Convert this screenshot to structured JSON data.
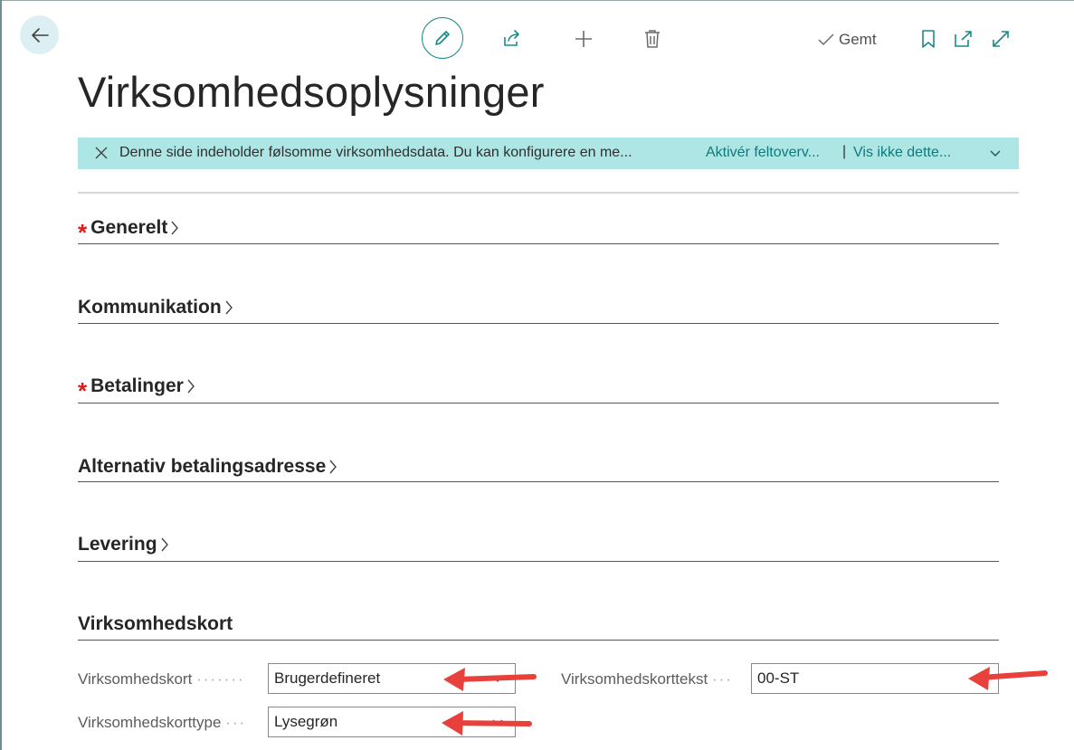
{
  "toolbar": {
    "back_icon": "arrow-left-icon",
    "edit_icon": "pencil-icon",
    "share_icon": "share-icon",
    "new_icon": "plus-icon",
    "delete_icon": "trash-icon",
    "saved_label": "Gemt",
    "bookmark_icon": "bookmark-icon",
    "popout_icon": "open-in-new-window-icon",
    "expand_icon": "expand-icon",
    "accent_color": "#1a8a86"
  },
  "page": {
    "title": "Virksomhedsoplysninger"
  },
  "banner": {
    "message": "Denne side indeholder følsomme virksomhedsdata. Du kan konfigurere en me...",
    "action1": "Aktivér feltoverv...",
    "separator": "|",
    "action2": "Vis ikke dette...",
    "background_color": "#aee6e6"
  },
  "sections": {
    "general": {
      "title": "Generelt",
      "required": true
    },
    "communication": {
      "title": "Kommunikation",
      "required": false
    },
    "payments": {
      "title": "Betalinger",
      "required": true
    },
    "alt_payment_address": {
      "title": "Alternativ betalingsadresse",
      "required": false
    },
    "delivery": {
      "title": "Levering",
      "required": false
    },
    "company_badge": {
      "title": "Virksomhedskort",
      "expanded": true
    }
  },
  "required_marker": "*",
  "company_badge": {
    "badge_label": "Virksomhedskort",
    "badge_value": "Brugerdefineret",
    "badge_text_label": "Virksomhedskorttekst",
    "badge_text_value": "00-ST",
    "badge_type_label": "Virksomhedskorttype",
    "badge_type_value": "Lysegrøn"
  },
  "annotation_color": "#e8403a"
}
